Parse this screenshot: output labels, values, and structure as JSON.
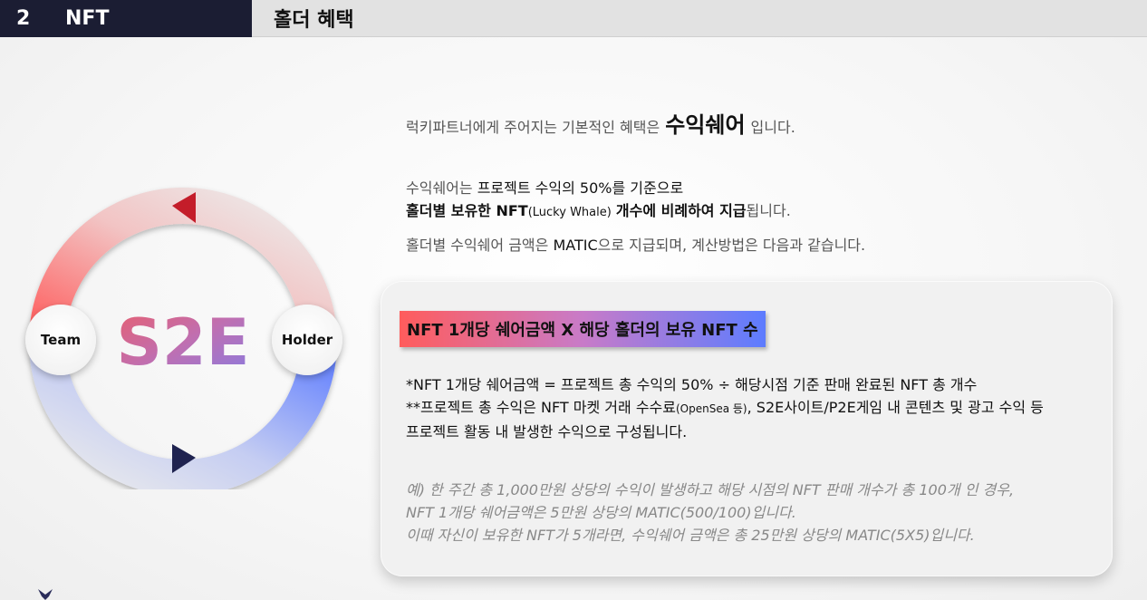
{
  "header": {
    "section_number": "2",
    "section_title": "NFT",
    "page_title": "홀더 혜택"
  },
  "intro": {
    "line1_prefix": "럭키파트너에게 주어지는 기본적인 혜택은",
    "line1_highlight": "수익쉐어",
    "line1_suffix": "입니다.",
    "p2_a": "수익쉐어는",
    "p2_b": "프로젝트 수익의 50%를 기준으로",
    "p2_c": "홀더별 보유한 NFT",
    "p2_d": "(Lucky Whale)",
    "p2_e": "개수에 비례하여 지급",
    "p2_f": "됩니다.",
    "p3_a": "홀더별 수익쉐어 금액은",
    "p3_b": "MATIC",
    "p3_c": "으로 지급되며, 계산방법은 다음과 같습니다."
  },
  "card": {
    "formula": "NFT 1개당 쉐어금액 X 해당 홀더의 보유 NFT 수",
    "note1": "*NFT 1개당 쉐어금액 = 프로젝트 총 수익의 50% ÷ 해당시점 기준 판매 완료된 NFT 총 개수",
    "note2_a": "**프로젝트 총 수익은 NFT 마켓 거래 수수료",
    "note2_b": "(OpenSea 등)",
    "note2_c": ", S2E사이트/P2E게임 내 콘텐츠 및 광고 수익 등",
    "note3": "프로젝트 활동 내 발생한 수익으로 구성됩니다.",
    "example1": "예) 한 주간 총 1,000만원 상당의 수익이 발생하고 해당 시점의 NFT 판매 개수가 총 100개 인 경우,",
    "example2": "NFT 1개당 쉐어금액은 5만원 상당의 MATIC(500/100)입니다.",
    "example3": "이때 자신이 보유한 NFT가 5개라면, 수익쉐어 금액은 총 25만원 상당의 MATIC(5X5)입니다."
  },
  "diagram": {
    "center_label": "S2E",
    "left_label": "Team",
    "right_label": "Holder",
    "colors": {
      "red": "#ff5a5a",
      "blue": "#5d7cff",
      "arrow_red": "#c41d2a",
      "arrow_navy": "#1f2350"
    }
  }
}
